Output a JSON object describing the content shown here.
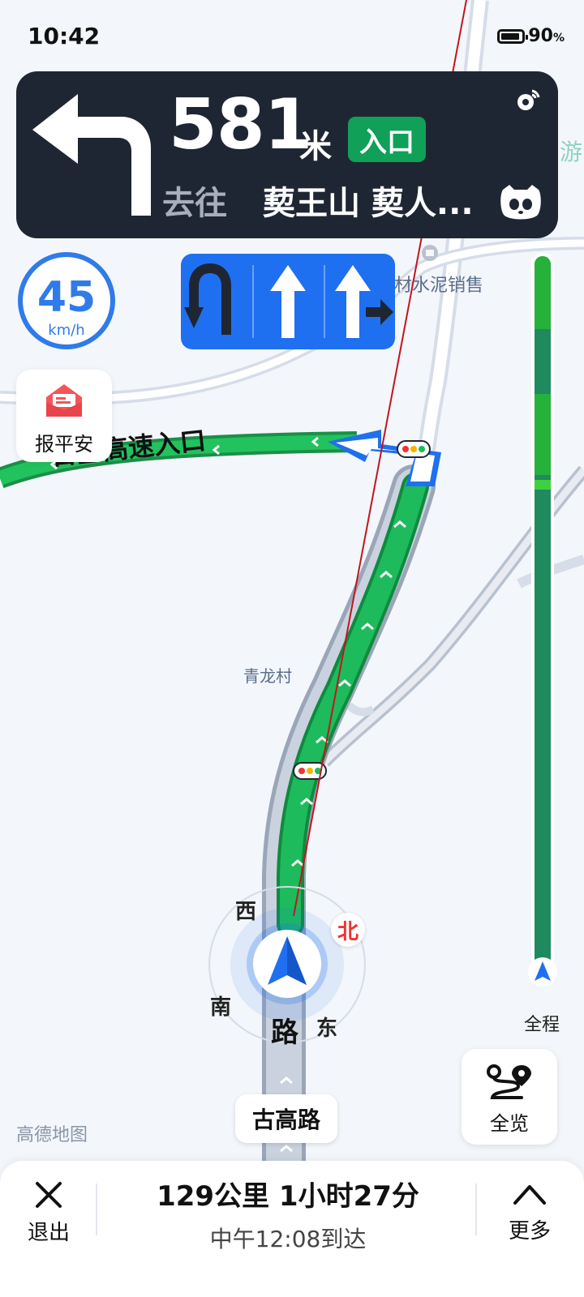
{
  "status_bar": {
    "time": "10:42",
    "battery": "90",
    "battery_unit": "%"
  },
  "guidance": {
    "distance": "581",
    "distance_unit": "米",
    "badge": "入口",
    "goto_label": "去往",
    "destination": "葜王山 葜人..."
  },
  "speed_limit": {
    "value": "45",
    "unit": "km/h"
  },
  "lanes": [
    "u-turn-left",
    "straight",
    "straight-right"
  ],
  "safe_report": {
    "label": "报平安"
  },
  "map": {
    "highway_label": "日宜高速入口",
    "place_cement": "材水泥销售",
    "place_village": "青龙村",
    "edge_label": "游",
    "road_char": "路"
  },
  "compass": {
    "north": "北",
    "west": "西",
    "south": "南",
    "east": "东"
  },
  "route_progress": {
    "label": "全程",
    "traveled_fraction": 0.0
  },
  "overview_button": {
    "label": "全览"
  },
  "current_road": "古高路",
  "brand": "高德地图",
  "bottom": {
    "exit_label": "退出",
    "summary": "129公里 1小时27分",
    "arrival": "中午12:08到达",
    "more_label": "更多"
  },
  "colors": {
    "route": "#1dbb5c",
    "card": "#1f2633",
    "accent": "#1f6ff1",
    "badge": "#10a058"
  }
}
